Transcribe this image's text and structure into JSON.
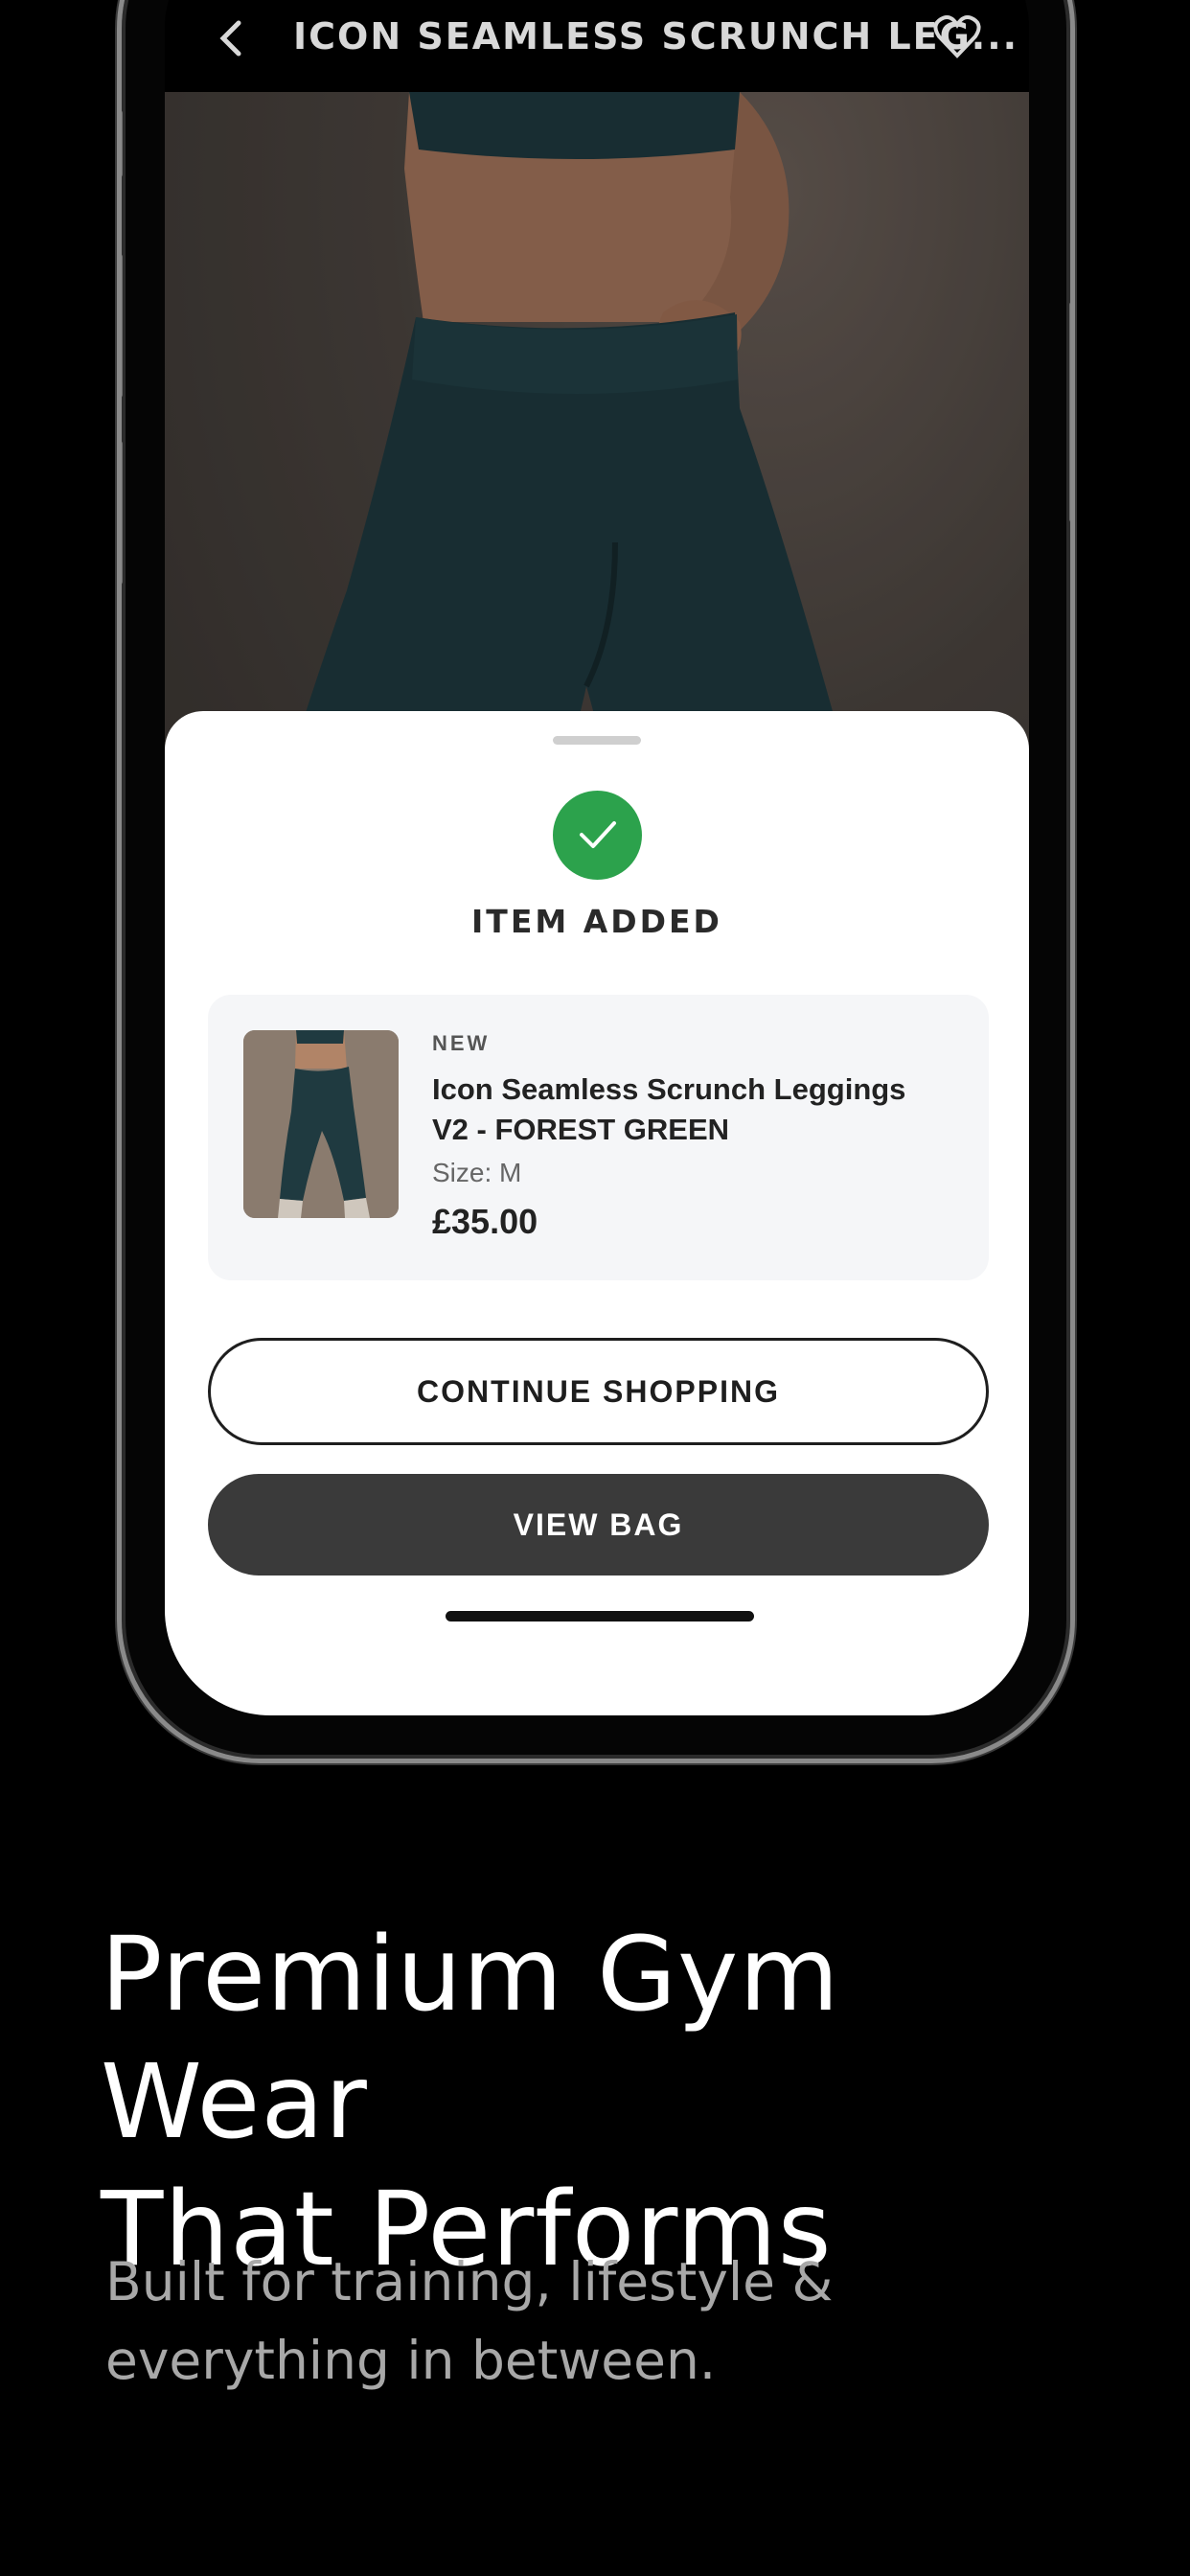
{
  "app": {
    "nav_title": "ICON SEAMLESS SCRUNCH LEG...",
    "icons": {
      "back": "chevron-left-icon",
      "favorite": "heart-icon"
    }
  },
  "sheet": {
    "status_title": "ITEM ADDED",
    "status_icon": "checkmark-icon",
    "status_color": "#2ca24c",
    "item": {
      "badge": "NEW",
      "name": "Icon Seamless Scrunch Leggings V2 - FOREST GREEN",
      "size": "Size: M",
      "price": "£35.00"
    },
    "continue_label": "CONTINUE SHOPPING",
    "view_bag_label": "VIEW BAG"
  },
  "marketing": {
    "headline_line1": "Premium Gym Wear",
    "headline_line2": "That Performs",
    "subline_line1": "Built for training, lifestyle &",
    "subline_line2": "everything in between."
  },
  "colors": {
    "background": "#000000",
    "leggings": "#1f3a40",
    "button_dark": "#3a3a3a"
  }
}
